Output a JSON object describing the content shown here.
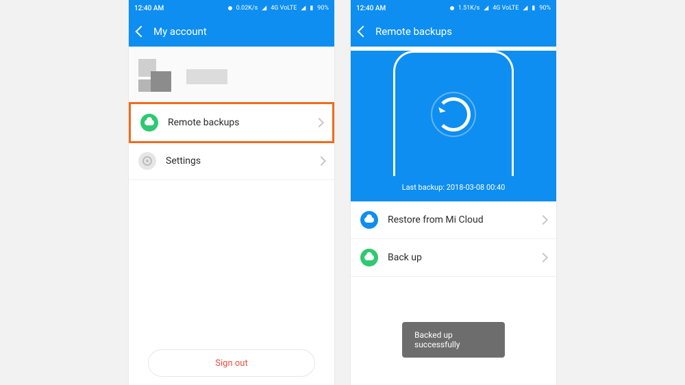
{
  "status": {
    "time": "12:40 AM",
    "speed_left": "0.02K/s",
    "speed_right": "1.51K/s",
    "net": "4G VoLTE",
    "battery": "90%"
  },
  "left": {
    "title": "My account",
    "remote_backups": "Remote backups",
    "settings": "Settings",
    "sign_out": "Sign out"
  },
  "right": {
    "title": "Remote backups",
    "last_backup": "Last backup: 2018-03-08 00:40",
    "restore": "Restore from Mi Cloud",
    "backup": "Back up",
    "toast": "Backed up successfully"
  }
}
